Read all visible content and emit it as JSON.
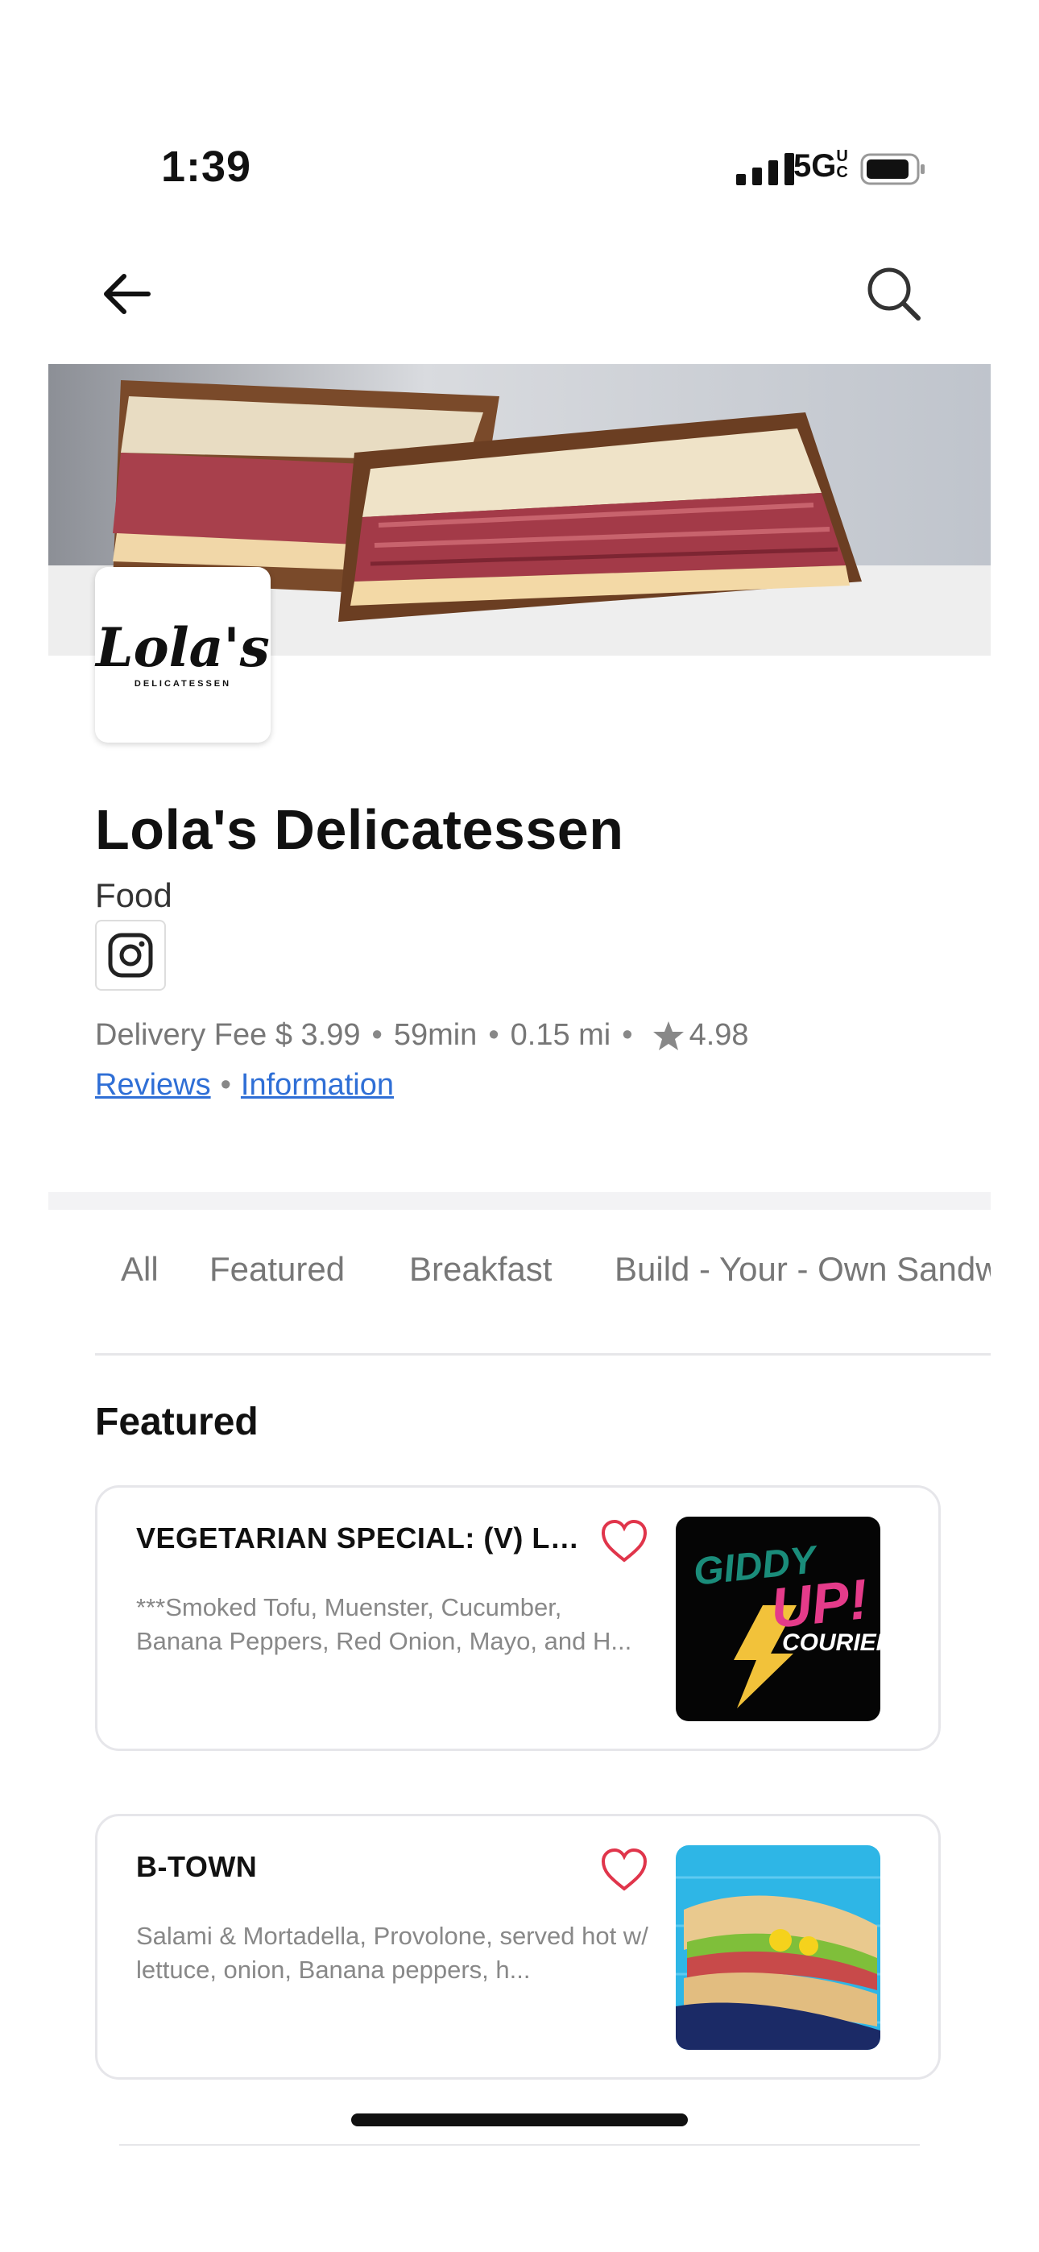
{
  "status_bar": {
    "time": "1:39",
    "network": "5G",
    "network_suffix": "UC",
    "icons": [
      "signal-icon",
      "battery-icon"
    ]
  },
  "nav": {
    "back_icon": "arrow-left-icon",
    "search_icon": "search-icon"
  },
  "store": {
    "logo_text": "Lola's",
    "logo_subtext": "DELICATESSEN",
    "name": "Lola's Delicatessen",
    "category": "Food",
    "social_icon": "instagram-icon",
    "delivery_fee": "Delivery Fee $ 3.99",
    "eta": "59min",
    "distance": "0.15 mi",
    "rating": "4.98",
    "reviews_label": "Reviews",
    "information_label": "Information"
  },
  "tabs": [
    {
      "label": "All"
    },
    {
      "label": "Featured"
    },
    {
      "label": "Breakfast"
    },
    {
      "label": "Build - Your - Own Sandwich"
    }
  ],
  "section": {
    "title": "Featured"
  },
  "items": [
    {
      "title": "VEGETARIAN SPECIAL: (V) LEBH...",
      "description": "***Smoked Tofu, Muenster, Cucumber, Banana Peppers, Red Onion, Mayo, and H...",
      "thumb_text_1": "GIDDY",
      "thumb_text_2": "UP!",
      "thumb_text_3": "COURIER"
    },
    {
      "title": "B-TOWN",
      "description": "Salami & Mortadella, Provolone, served hot w/ lettuce,  onion, Banana peppers, h..."
    }
  ],
  "colors": {
    "link": "#2f6fd6",
    "heart": "#e0354b",
    "star": "#888888"
  }
}
